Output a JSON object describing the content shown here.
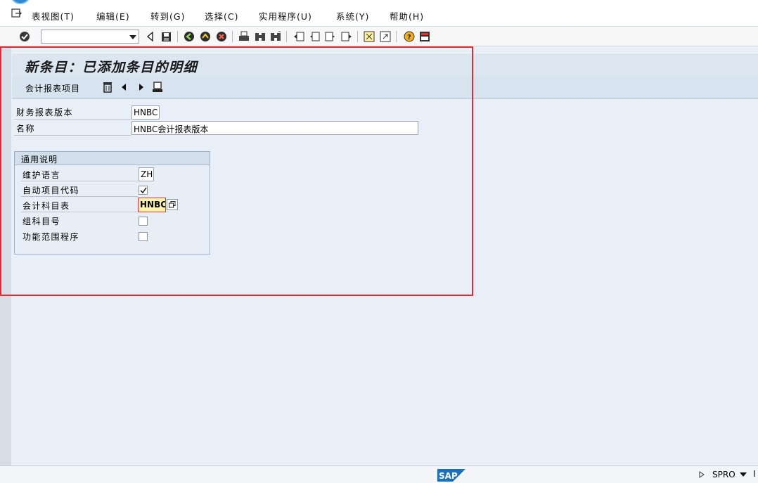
{
  "menu": {
    "items": [
      {
        "label": "表视图(T)"
      },
      {
        "label": "编辑(E)"
      },
      {
        "label": "转到(G)"
      },
      {
        "label": "选择(C)"
      },
      {
        "label": "实用程序(U)"
      },
      {
        "label": "系统(Y)"
      },
      {
        "label": "帮助(H)"
      }
    ]
  },
  "toolbar": {
    "command_value": "",
    "icons": [
      "enter-icon",
      "command-dropdown-icon",
      "back-arrow-icon",
      "save-icon",
      "back-icon",
      "exit-icon",
      "cancel-icon",
      "print-icon",
      "find-icon",
      "find-next-icon",
      "first-page-icon",
      "previous-page-icon",
      "next-page-icon",
      "last-page-icon",
      "create-session-icon",
      "shortcut-icon",
      "help-icon",
      "layout-icon"
    ]
  },
  "page": {
    "title": "新条目：已添加条目的明细"
  },
  "app_toolbar": {
    "label": "会计报表项目"
  },
  "fields": {
    "fsv_version_label": "财务报表版本",
    "fsv_version_value": "HNBC",
    "name_label": "名称",
    "name_value": "HNBC会计报表版本"
  },
  "general": {
    "title": "通用说明",
    "maint_lang_label": "维护语言",
    "maint_lang_value": "ZH",
    "auto_item_code_label": "自动项目代码",
    "auto_item_code_checked": true,
    "coa_label": "会计科目表",
    "coa_value": "HNBC",
    "group_account_label": "组科目号",
    "group_account_checked": false,
    "func_area_label": "功能范围程序",
    "func_area_checked": false
  },
  "status": {
    "logo_text": "SAP",
    "system": "SPRO",
    "trailing": "I"
  },
  "colors": {
    "highlight_frame": "#e8282c",
    "focus_field": "#fff3b0",
    "title_bar": "#dbe6f0"
  }
}
